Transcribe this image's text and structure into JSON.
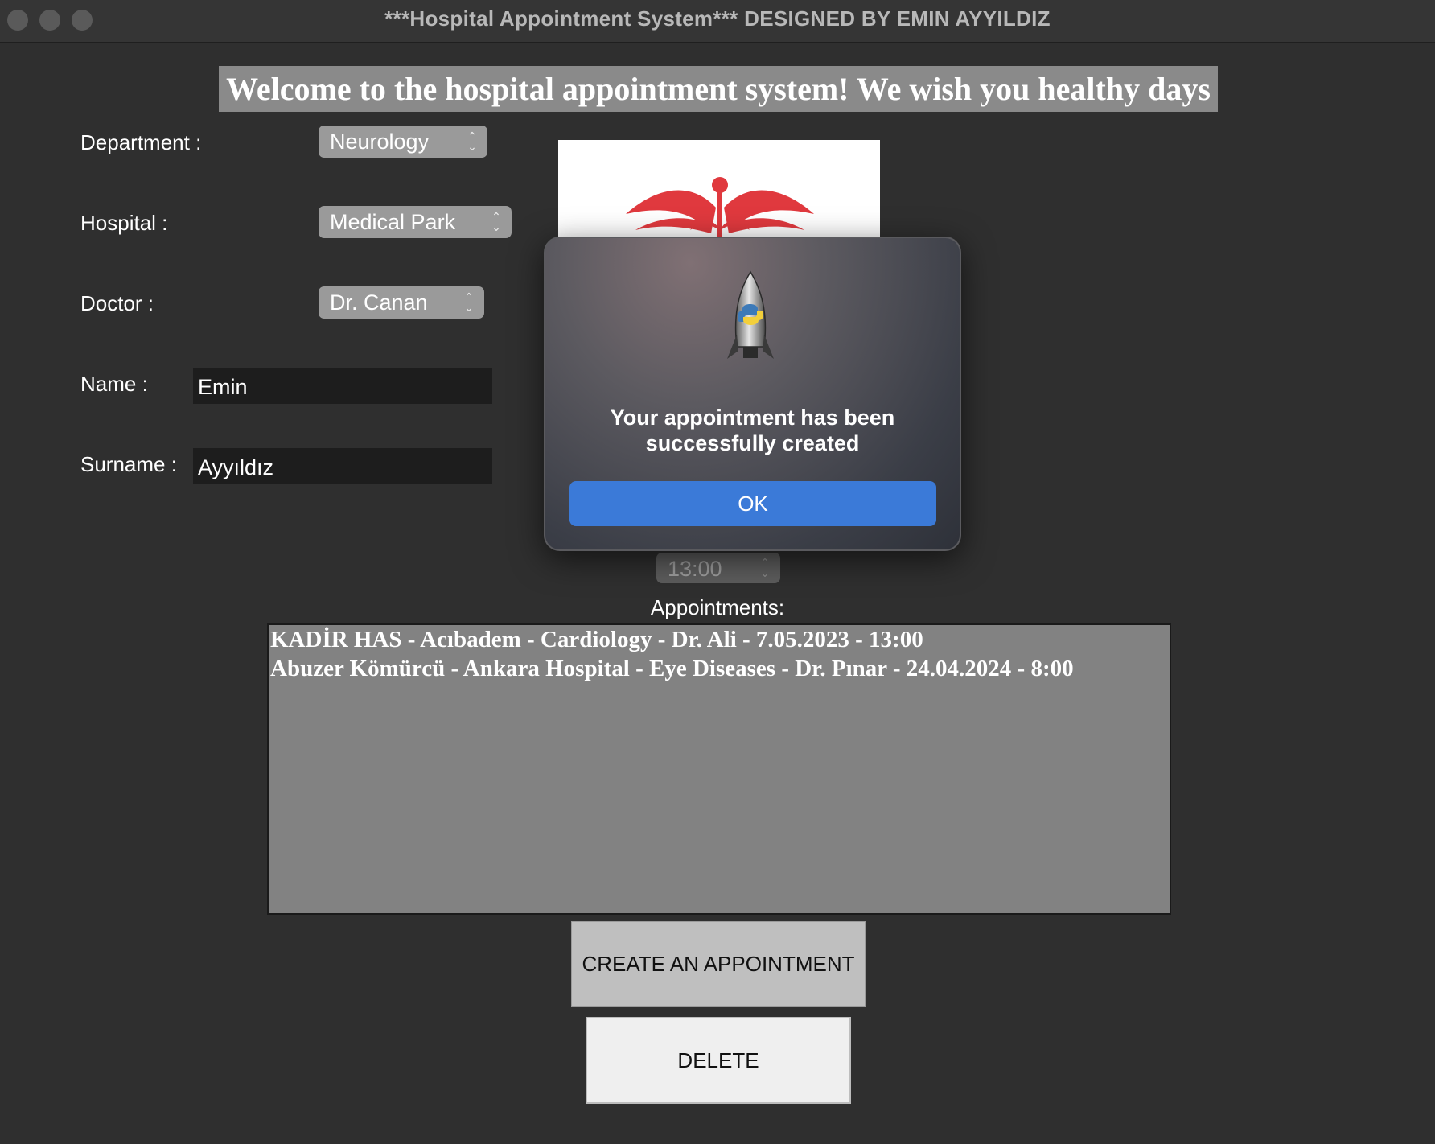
{
  "window": {
    "title": "***Hospital Appointment System*** DESIGNED BY EMIN AYYILDIZ"
  },
  "welcome_banner": "Welcome to the hospital appointment system! We wish you healthy days",
  "form": {
    "department_label": "Department :",
    "department_value": "Neurology",
    "hospital_label": "Hospital :",
    "hospital_value": "Medical Park",
    "doctor_label": "Doctor :",
    "doctor_value": "Dr. Canan",
    "name_label": "Name :",
    "name_value": "Emin",
    "surname_label": "Surname :",
    "surname_value": "Ayyıldız",
    "time_value": "13:00"
  },
  "appointments": {
    "label": "Appointments:",
    "items": [
      "KADİR HAS - Acıbadem - Cardiology - Dr. Ali - 7.05.2023 - 13:00",
      "Abuzer Kömürcü - Ankara Hospital - Eye Diseases - Dr. Pınar - 24.04.2024 - 8:00"
    ]
  },
  "buttons": {
    "create": "CREATE AN APPOINTMENT",
    "delete": "DELETE"
  },
  "dialog": {
    "message_line1": "Your appointment has been",
    "message_line2": "successfully created",
    "ok": "OK",
    "icon": "python-launcher-rocket-icon"
  },
  "colors": {
    "window_bg": "#2f2f2f",
    "banner_bg": "#8a8a8a",
    "listbox_bg": "#828282",
    "ok_button": "#3b7ad8",
    "caduceus": "#e0393e"
  }
}
